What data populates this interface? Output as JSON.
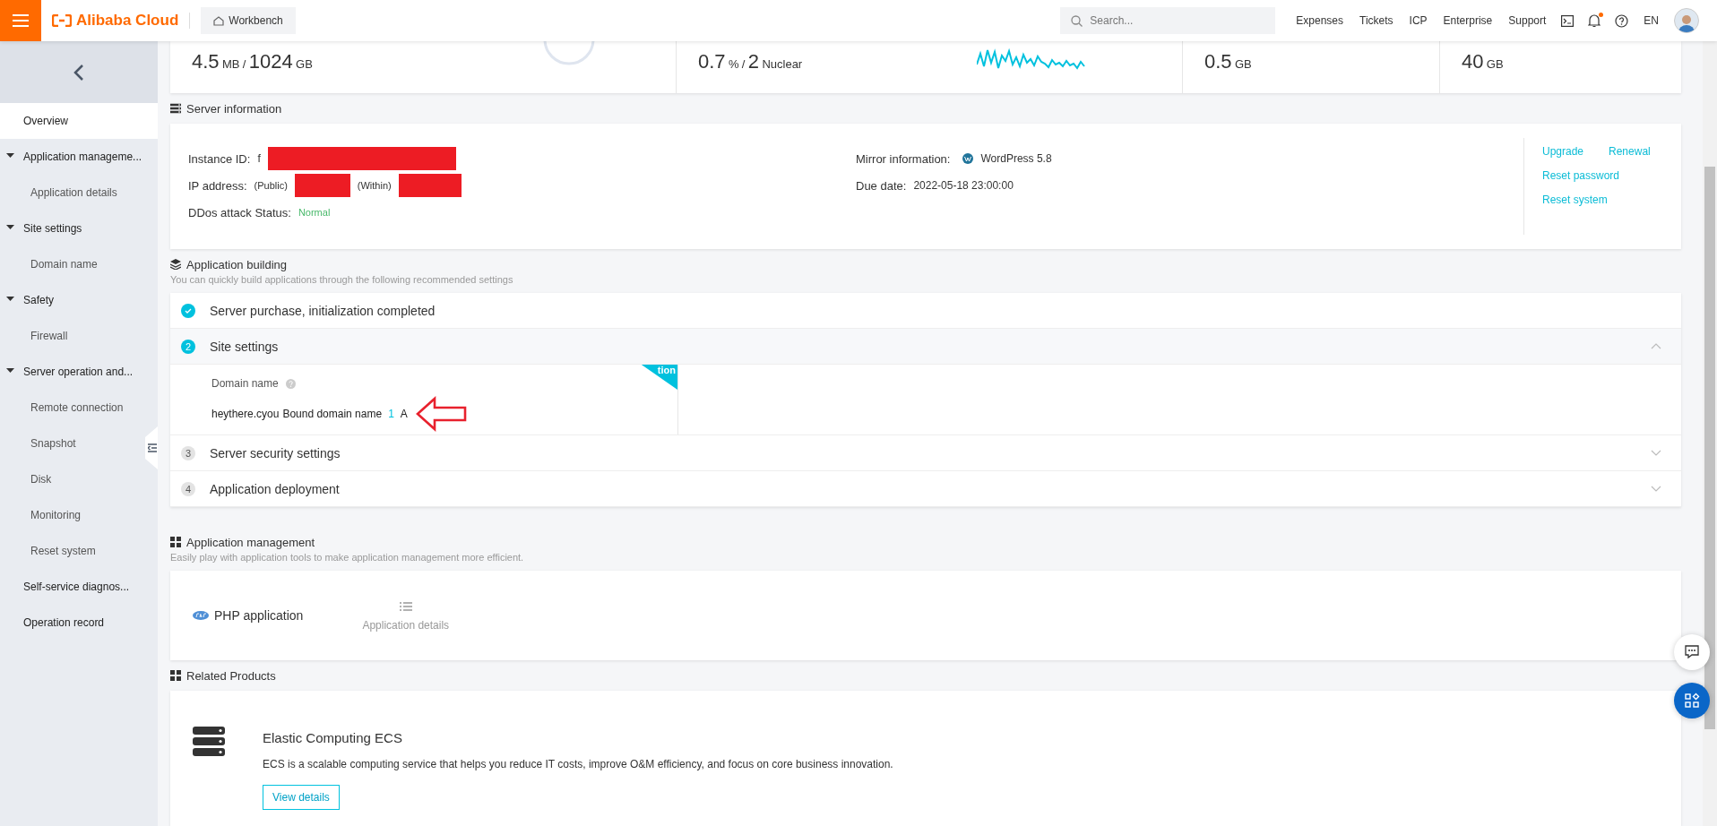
{
  "topbar": {
    "logo": "Alibaba Cloud",
    "workbench": "Workbench",
    "search": {
      "placeholder": "Search..."
    },
    "links": [
      "Expenses",
      "Tickets",
      "ICP",
      "Enterprise",
      "Support"
    ],
    "notification_dot": true,
    "language": "EN"
  },
  "sidebar": {
    "items": [
      {
        "label": "Overview",
        "selected": true
      },
      {
        "label": "Application manageme...",
        "selected": false,
        "expanded": true,
        "children": [
          {
            "label": "Application details",
            "selected": false
          }
        ]
      },
      {
        "label": "Site settings",
        "selected": false,
        "expanded": true,
        "children": [
          {
            "label": "Domain name",
            "selected": false
          }
        ]
      },
      {
        "label": "Safety",
        "selected": false,
        "expanded": true,
        "children": [
          {
            "label": "Firewall",
            "selected": false
          }
        ]
      },
      {
        "label": "Server operation and...",
        "selected": false,
        "expanded": true,
        "children": [
          {
            "label": "Remote connection",
            "selected": false
          },
          {
            "label": "Snapshot",
            "selected": false
          },
          {
            "label": "Disk",
            "selected": false
          },
          {
            "label": "Monitoring",
            "selected": false
          },
          {
            "label": "Reset system",
            "selected": false
          }
        ]
      },
      {
        "label": "Self-service diagnos...",
        "selected": false
      },
      {
        "label": "Operation record",
        "selected": false
      }
    ]
  },
  "metrics": [
    {
      "kind": "gauge",
      "parts": [
        "4.5",
        "MB",
        "/",
        "1024",
        "GB"
      ]
    },
    {
      "kind": "sparkline",
      "parts": [
        "0.7",
        "%",
        "/",
        "2",
        "Nuclear"
      ]
    },
    {
      "kind": "plain",
      "parts": [
        "0.5",
        "GB"
      ]
    },
    {
      "kind": "plain",
      "parts": [
        "40",
        "GB"
      ]
    }
  ],
  "server_information": {
    "title": "Server information",
    "left": [
      {
        "label": "Instance ID:",
        "value": "f",
        "redacted": true
      },
      {
        "label": "IP address:",
        "public": "(Public)",
        "within": "(Within)",
        "redacted": true
      },
      {
        "label": "DDos attack Status:",
        "value": "Normal",
        "redacted": false
      }
    ],
    "right": [
      {
        "label": "Mirror information:",
        "value": "WordPress 5.8"
      },
      {
        "label": "Due date:",
        "value": "2022-05-18 23:00:00"
      }
    ],
    "actions": [
      [
        "Upgrade",
        "Renewal"
      ],
      [
        "Reset password"
      ],
      [
        "Reset system"
      ]
    ]
  },
  "application_building": {
    "title": "Application building",
    "subtitle": "You can quickly build applications through the following recommended settings",
    "steps": [
      {
        "kind": "completed",
        "label": "Server purchase, initialization completed"
      },
      {
        "kind": "step",
        "number": "2",
        "label": "Site settings",
        "expanded": true,
        "active": true,
        "ribbon": "tion",
        "field_label": "Domain name",
        "domain": "heythere.cyou",
        "bound_text": "Bound domain name",
        "count": "1",
        "unit": "A"
      },
      {
        "kind": "step",
        "number": "3",
        "label": "Server security settings",
        "expanded": false,
        "active": false
      },
      {
        "kind": "step",
        "number": "4",
        "label": "Application deployment",
        "expanded": false,
        "active": false
      }
    ]
  },
  "application_management": {
    "title": "Application management",
    "subtitle": "Easily play with application tools to make application management more efficient.",
    "app": "PHP application",
    "details": "Application details"
  },
  "related_products": {
    "title": "Related Products",
    "product": {
      "name": "Elastic Computing ECS",
      "description": "ECS is a scalable computing service that helps you reduce IT costs, improve O&M efficiency, and focus on core business innovation.",
      "button": "View details"
    }
  }
}
